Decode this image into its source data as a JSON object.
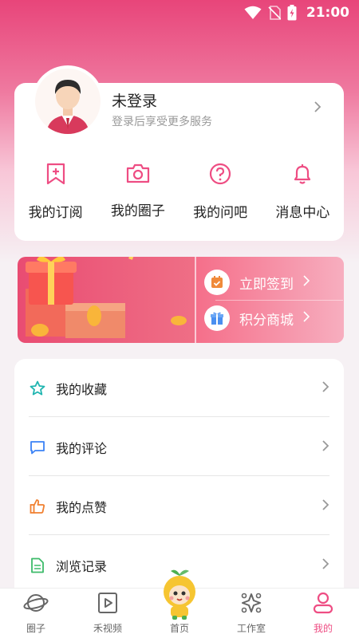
{
  "status_bar": {
    "time": "21:00"
  },
  "profile": {
    "username": "未登录",
    "login_hint": "登录后享受更多服务"
  },
  "quick_actions": [
    {
      "label": "我的订阅",
      "icon": "bookmark-plus-icon"
    },
    {
      "label": "我的圈子",
      "icon": "camera-icon"
    },
    {
      "label": "我的问吧",
      "icon": "question-circle-icon"
    },
    {
      "label": "消息中心",
      "icon": "bell-icon"
    }
  ],
  "banner": {
    "checkin_label": "立即签到",
    "mall_label": "积分商城"
  },
  "menu": [
    {
      "label": "我的收藏",
      "icon": "star-icon",
      "color": "#1fb5b0"
    },
    {
      "label": "我的评论",
      "icon": "comment-icon",
      "color": "#3b82f6"
    },
    {
      "label": "我的点赞",
      "icon": "thumbs-up-icon",
      "color": "#f08030"
    },
    {
      "label": "浏览记录",
      "icon": "document-icon",
      "color": "#3dbb6a"
    }
  ],
  "tabs": [
    {
      "label": "圈子",
      "icon": "planet-icon"
    },
    {
      "label": "禾视频",
      "icon": "video-play-icon"
    },
    {
      "label": "首页",
      "icon": "mascot-icon"
    },
    {
      "label": "工作室",
      "icon": "studio-icon"
    },
    {
      "label": "我的",
      "icon": "user-icon",
      "active": true
    }
  ],
  "colors": {
    "accent": "#ee4d83",
    "header_gradient_top": "#e8457a"
  }
}
